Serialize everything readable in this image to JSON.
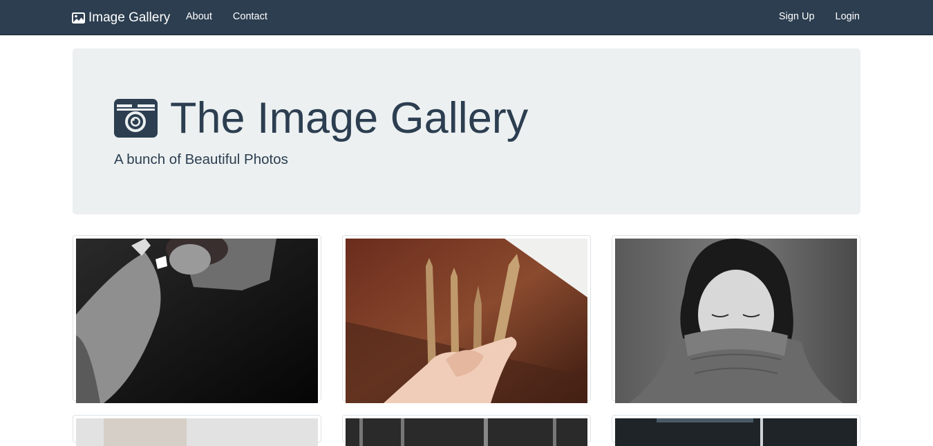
{
  "navbar": {
    "brand_icon": "image-icon",
    "brand_label": "Image Gallery",
    "left_links": [
      {
        "label": "About"
      },
      {
        "label": "Contact"
      }
    ],
    "right_links": [
      {
        "label": "Sign Up"
      },
      {
        "label": "Login"
      }
    ],
    "background": "#2c3e50"
  },
  "jumbotron": {
    "icon": "camera-icon",
    "title": "The Image Gallery",
    "subtitle": "A bunch of Beautiful Photos",
    "background": "#ecf0f1",
    "text_color": "#2c3e50"
  },
  "gallery": {
    "photos": [
      {
        "subject": "person-with-cigarette-bw"
      },
      {
        "subject": "hand-holding-pencils"
      },
      {
        "subject": "woman-turtleneck-bw"
      },
      {
        "subject": "photo-4"
      },
      {
        "subject": "photo-5"
      },
      {
        "subject": "photo-6"
      }
    ]
  }
}
